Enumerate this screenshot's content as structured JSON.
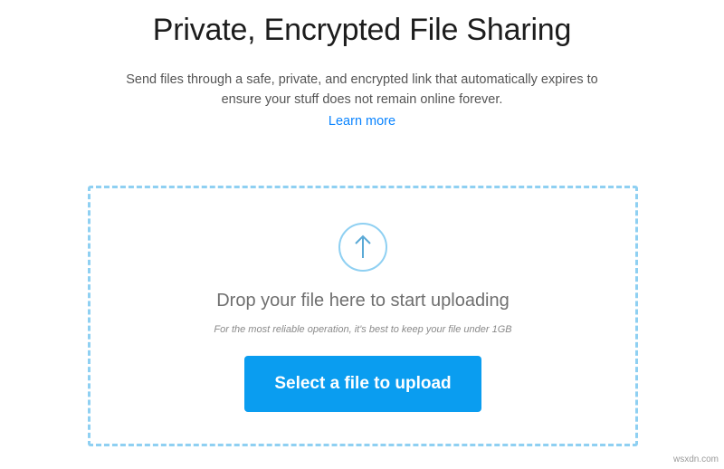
{
  "header": {
    "title": "Private, Encrypted File Sharing",
    "description": "Send files through a safe, private, and encrypted link that automatically expires to ensure your stuff does not remain online forever.",
    "learn_more": "Learn more"
  },
  "dropzone": {
    "icon": "upload-arrow-icon",
    "heading": "Drop your file here to start uploading",
    "note": "For the most reliable operation, it's best to keep your file under 1GB",
    "button_label": "Select a file to upload"
  },
  "watermark": "wsxdn.com",
  "colors": {
    "accent": "#0a9df0",
    "link": "#0a84ff",
    "dashed_border": "#8fd0f2"
  }
}
